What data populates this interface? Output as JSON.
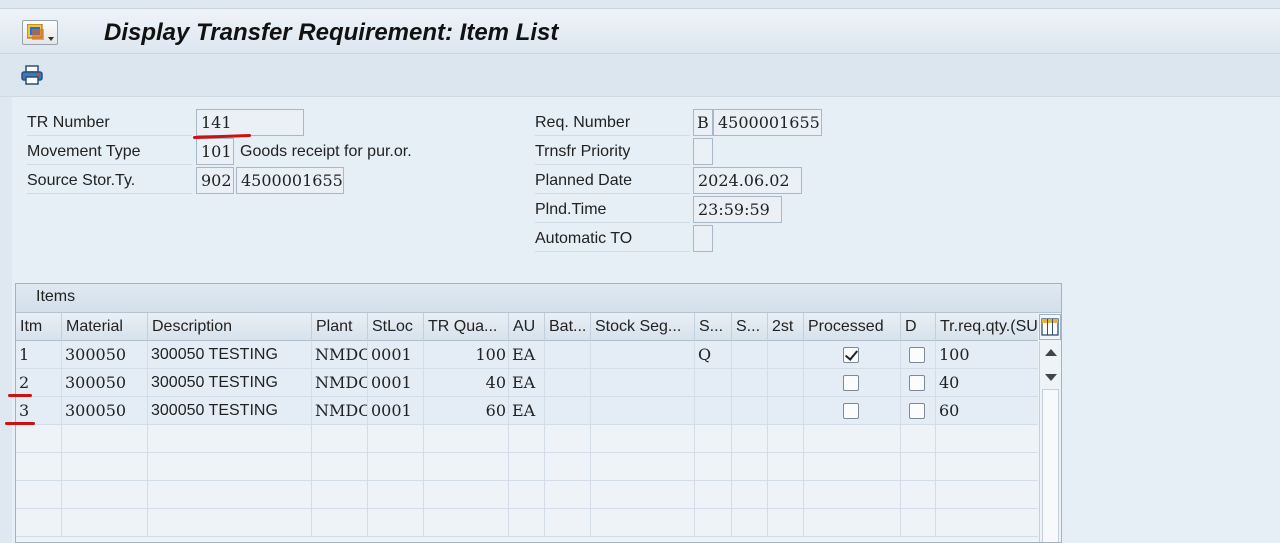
{
  "window": {
    "title": "Display Transfer Requirement: Item List"
  },
  "toolbar": {
    "icons": [
      "print-icon"
    ]
  },
  "header_fields": {
    "tr_number": {
      "label": "TR Number",
      "value": "141"
    },
    "movement_type": {
      "label": "Movement Type",
      "code": "101",
      "text": "Goods receipt for pur.or."
    },
    "source_stor_ty": {
      "label": "Source Stor.Ty.",
      "code": "902",
      "value": "4500001655"
    },
    "req_number": {
      "label": "Req. Number",
      "prefix": "B",
      "value": "4500001655"
    },
    "trnsfr_priority": {
      "label": "Trnsfr Priority",
      "value": ""
    },
    "planned_date": {
      "label": "Planned Date",
      "value": "2024.06.02"
    },
    "plnd_time": {
      "label": "Plnd.Time",
      "value": "23:59:59"
    },
    "automatic_to": {
      "label": "Automatic TO",
      "value": ""
    }
  },
  "items": {
    "title": "Items",
    "columns": [
      "Itm",
      "Material",
      "Description",
      "Plant",
      "StLoc",
      "TR Qua...",
      "AU",
      "Bat...",
      "Stock Seg...",
      "S...",
      "S...",
      "2st",
      "Processed",
      "D",
      "Tr.req.qty.(SU"
    ],
    "rows": [
      {
        "itm": "1",
        "material": "300050",
        "description": "300050 TESTING",
        "plant": "NMDC",
        "stloc": "0001",
        "tr_qty": "100",
        "au": "EA",
        "s1": "Q",
        "processed": true,
        "d": false,
        "tr_req_qty": "100"
      },
      {
        "itm": "2",
        "material": "300050",
        "description": "300050 TESTING",
        "plant": "NMDC",
        "stloc": "0001",
        "tr_qty": "40",
        "au": "EA",
        "s1": "",
        "processed": false,
        "d": false,
        "tr_req_qty": "40"
      },
      {
        "itm": "3",
        "material": "300050",
        "description": "300050 TESTING",
        "plant": "NMDC",
        "stloc": "0001",
        "tr_qty": "60",
        "au": "EA",
        "s1": "",
        "processed": false,
        "d": false,
        "tr_req_qty": "60"
      }
    ]
  },
  "colors": {
    "annotation": "#cc1111",
    "background": "#e6eef6"
  }
}
